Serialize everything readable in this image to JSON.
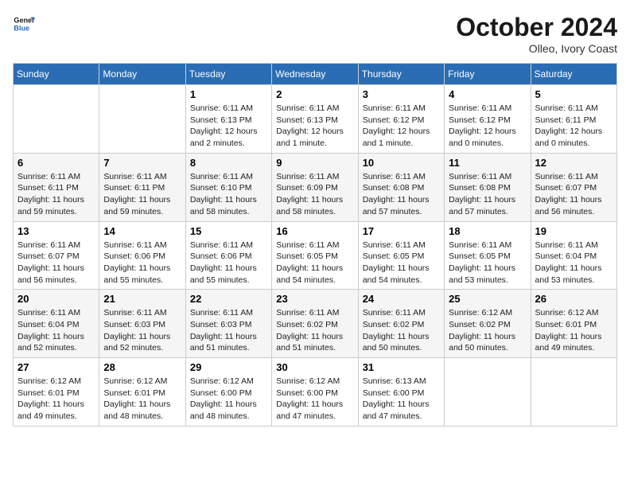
{
  "logo": {
    "line1": "General",
    "line2": "Blue"
  },
  "title": "October 2024",
  "location": "Olleo, Ivory Coast",
  "weekdays": [
    "Sunday",
    "Monday",
    "Tuesday",
    "Wednesday",
    "Thursday",
    "Friday",
    "Saturday"
  ],
  "weeks": [
    [
      {
        "day": "",
        "info": ""
      },
      {
        "day": "",
        "info": ""
      },
      {
        "day": "1",
        "info": "Sunrise: 6:11 AM\nSunset: 6:13 PM\nDaylight: 12 hours\nand 2 minutes."
      },
      {
        "day": "2",
        "info": "Sunrise: 6:11 AM\nSunset: 6:13 PM\nDaylight: 12 hours\nand 1 minute."
      },
      {
        "day": "3",
        "info": "Sunrise: 6:11 AM\nSunset: 6:12 PM\nDaylight: 12 hours\nand 1 minute."
      },
      {
        "day": "4",
        "info": "Sunrise: 6:11 AM\nSunset: 6:12 PM\nDaylight: 12 hours\nand 0 minutes."
      },
      {
        "day": "5",
        "info": "Sunrise: 6:11 AM\nSunset: 6:11 PM\nDaylight: 12 hours\nand 0 minutes."
      }
    ],
    [
      {
        "day": "6",
        "info": "Sunrise: 6:11 AM\nSunset: 6:11 PM\nDaylight: 11 hours\nand 59 minutes."
      },
      {
        "day": "7",
        "info": "Sunrise: 6:11 AM\nSunset: 6:11 PM\nDaylight: 11 hours\nand 59 minutes."
      },
      {
        "day": "8",
        "info": "Sunrise: 6:11 AM\nSunset: 6:10 PM\nDaylight: 11 hours\nand 58 minutes."
      },
      {
        "day": "9",
        "info": "Sunrise: 6:11 AM\nSunset: 6:09 PM\nDaylight: 11 hours\nand 58 minutes."
      },
      {
        "day": "10",
        "info": "Sunrise: 6:11 AM\nSunset: 6:08 PM\nDaylight: 11 hours\nand 57 minutes."
      },
      {
        "day": "11",
        "info": "Sunrise: 6:11 AM\nSunset: 6:08 PM\nDaylight: 11 hours\nand 57 minutes."
      },
      {
        "day": "12",
        "info": "Sunrise: 6:11 AM\nSunset: 6:07 PM\nDaylight: 11 hours\nand 56 minutes."
      }
    ],
    [
      {
        "day": "13",
        "info": "Sunrise: 6:11 AM\nSunset: 6:07 PM\nDaylight: 11 hours\nand 56 minutes."
      },
      {
        "day": "14",
        "info": "Sunrise: 6:11 AM\nSunset: 6:06 PM\nDaylight: 11 hours\nand 55 minutes."
      },
      {
        "day": "15",
        "info": "Sunrise: 6:11 AM\nSunset: 6:06 PM\nDaylight: 11 hours\nand 55 minutes."
      },
      {
        "day": "16",
        "info": "Sunrise: 6:11 AM\nSunset: 6:05 PM\nDaylight: 11 hours\nand 54 minutes."
      },
      {
        "day": "17",
        "info": "Sunrise: 6:11 AM\nSunset: 6:05 PM\nDaylight: 11 hours\nand 54 minutes."
      },
      {
        "day": "18",
        "info": "Sunrise: 6:11 AM\nSunset: 6:05 PM\nDaylight: 11 hours\nand 53 minutes."
      },
      {
        "day": "19",
        "info": "Sunrise: 6:11 AM\nSunset: 6:04 PM\nDaylight: 11 hours\nand 53 minutes."
      }
    ],
    [
      {
        "day": "20",
        "info": "Sunrise: 6:11 AM\nSunset: 6:04 PM\nDaylight: 11 hours\nand 52 minutes."
      },
      {
        "day": "21",
        "info": "Sunrise: 6:11 AM\nSunset: 6:03 PM\nDaylight: 11 hours\nand 52 minutes."
      },
      {
        "day": "22",
        "info": "Sunrise: 6:11 AM\nSunset: 6:03 PM\nDaylight: 11 hours\nand 51 minutes."
      },
      {
        "day": "23",
        "info": "Sunrise: 6:11 AM\nSunset: 6:02 PM\nDaylight: 11 hours\nand 51 minutes."
      },
      {
        "day": "24",
        "info": "Sunrise: 6:11 AM\nSunset: 6:02 PM\nDaylight: 11 hours\nand 50 minutes."
      },
      {
        "day": "25",
        "info": "Sunrise: 6:12 AM\nSunset: 6:02 PM\nDaylight: 11 hours\nand 50 minutes."
      },
      {
        "day": "26",
        "info": "Sunrise: 6:12 AM\nSunset: 6:01 PM\nDaylight: 11 hours\nand 49 minutes."
      }
    ],
    [
      {
        "day": "27",
        "info": "Sunrise: 6:12 AM\nSunset: 6:01 PM\nDaylight: 11 hours\nand 49 minutes."
      },
      {
        "day": "28",
        "info": "Sunrise: 6:12 AM\nSunset: 6:01 PM\nDaylight: 11 hours\nand 48 minutes."
      },
      {
        "day": "29",
        "info": "Sunrise: 6:12 AM\nSunset: 6:00 PM\nDaylight: 11 hours\nand 48 minutes."
      },
      {
        "day": "30",
        "info": "Sunrise: 6:12 AM\nSunset: 6:00 PM\nDaylight: 11 hours\nand 47 minutes."
      },
      {
        "day": "31",
        "info": "Sunrise: 6:13 AM\nSunset: 6:00 PM\nDaylight: 11 hours\nand 47 minutes."
      },
      {
        "day": "",
        "info": ""
      },
      {
        "day": "",
        "info": ""
      }
    ]
  ]
}
